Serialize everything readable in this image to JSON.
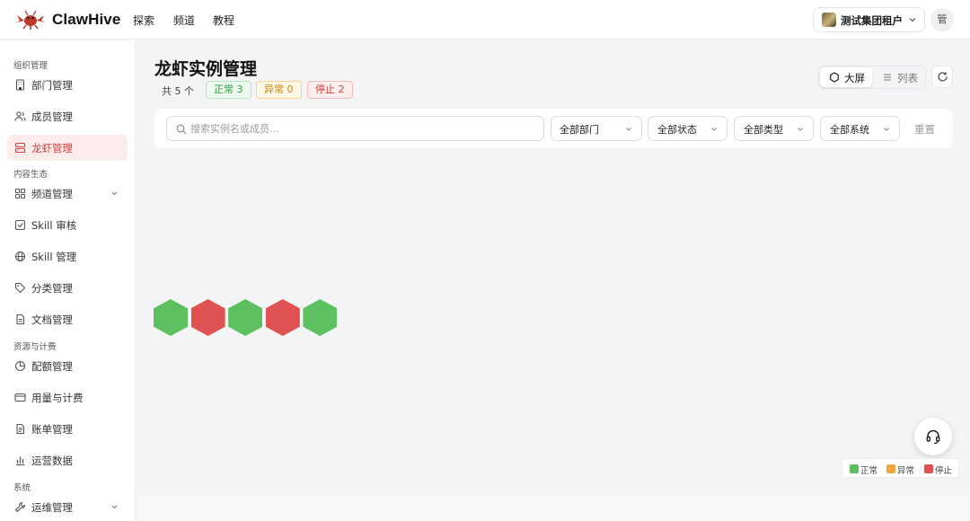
{
  "app": {
    "brand": "ClawHive"
  },
  "topnav": [
    "探索",
    "频道",
    "教程"
  ],
  "tenant": {
    "name": "测试集团租户"
  },
  "user": {
    "avatar_text": "管"
  },
  "sidebar": {
    "sections": [
      {
        "title": "组织管理",
        "items": [
          {
            "label": "部门管理",
            "icon": "building-icon"
          },
          {
            "label": "成员管理",
            "icon": "users-icon"
          },
          {
            "label": "龙虾管理",
            "icon": "server-icon",
            "active": true
          }
        ]
      },
      {
        "title": "内容生态",
        "items": [
          {
            "label": "频道管理",
            "icon": "grid-icon",
            "expandable": true
          },
          {
            "label": "Skill 审核",
            "icon": "check-square-icon"
          },
          {
            "label": "Skill 管理",
            "icon": "globe-icon"
          },
          {
            "label": "分类管理",
            "icon": "tag-icon"
          },
          {
            "label": "文档管理",
            "icon": "document-icon"
          }
        ]
      },
      {
        "title": "资源与计费",
        "items": [
          {
            "label": "配额管理",
            "icon": "pie-chart-icon"
          },
          {
            "label": "用量与计费",
            "icon": "credit-card-icon"
          },
          {
            "label": "账单管理",
            "icon": "receipt-icon"
          },
          {
            "label": "运营数据",
            "icon": "bar-chart-icon"
          }
        ]
      },
      {
        "title": "系统",
        "items": [
          {
            "label": "运维管理",
            "icon": "wrench-icon",
            "expandable": true
          }
        ]
      }
    ]
  },
  "main": {
    "title": "龙虾实例管理",
    "total": "共 5 个",
    "badges": {
      "normal": "正常 3",
      "abnormal": "异常 0",
      "stopped": "停止 2"
    },
    "view_toggle": {
      "screen": "大屏",
      "list": "列表",
      "selected": "screen"
    },
    "filters": {
      "search_placeholder": "搜索实例名或成员...",
      "department": "全部部门",
      "status": "全部状态",
      "type": "全部类型",
      "system": "全部系统",
      "reset": "重置"
    },
    "instances": [
      "normal",
      "stopped",
      "normal",
      "stopped",
      "normal"
    ],
    "legend": [
      {
        "label": "正常",
        "color": "#5cbf60"
      },
      {
        "label": "异常",
        "color": "#f0a63c"
      },
      {
        "label": "停止",
        "color": "#e05252"
      }
    ]
  },
  "colors": {
    "accent": "#d83b3b",
    "normal": "#5cbf60",
    "abnormal": "#f0a63c",
    "stopped": "#e05252"
  }
}
